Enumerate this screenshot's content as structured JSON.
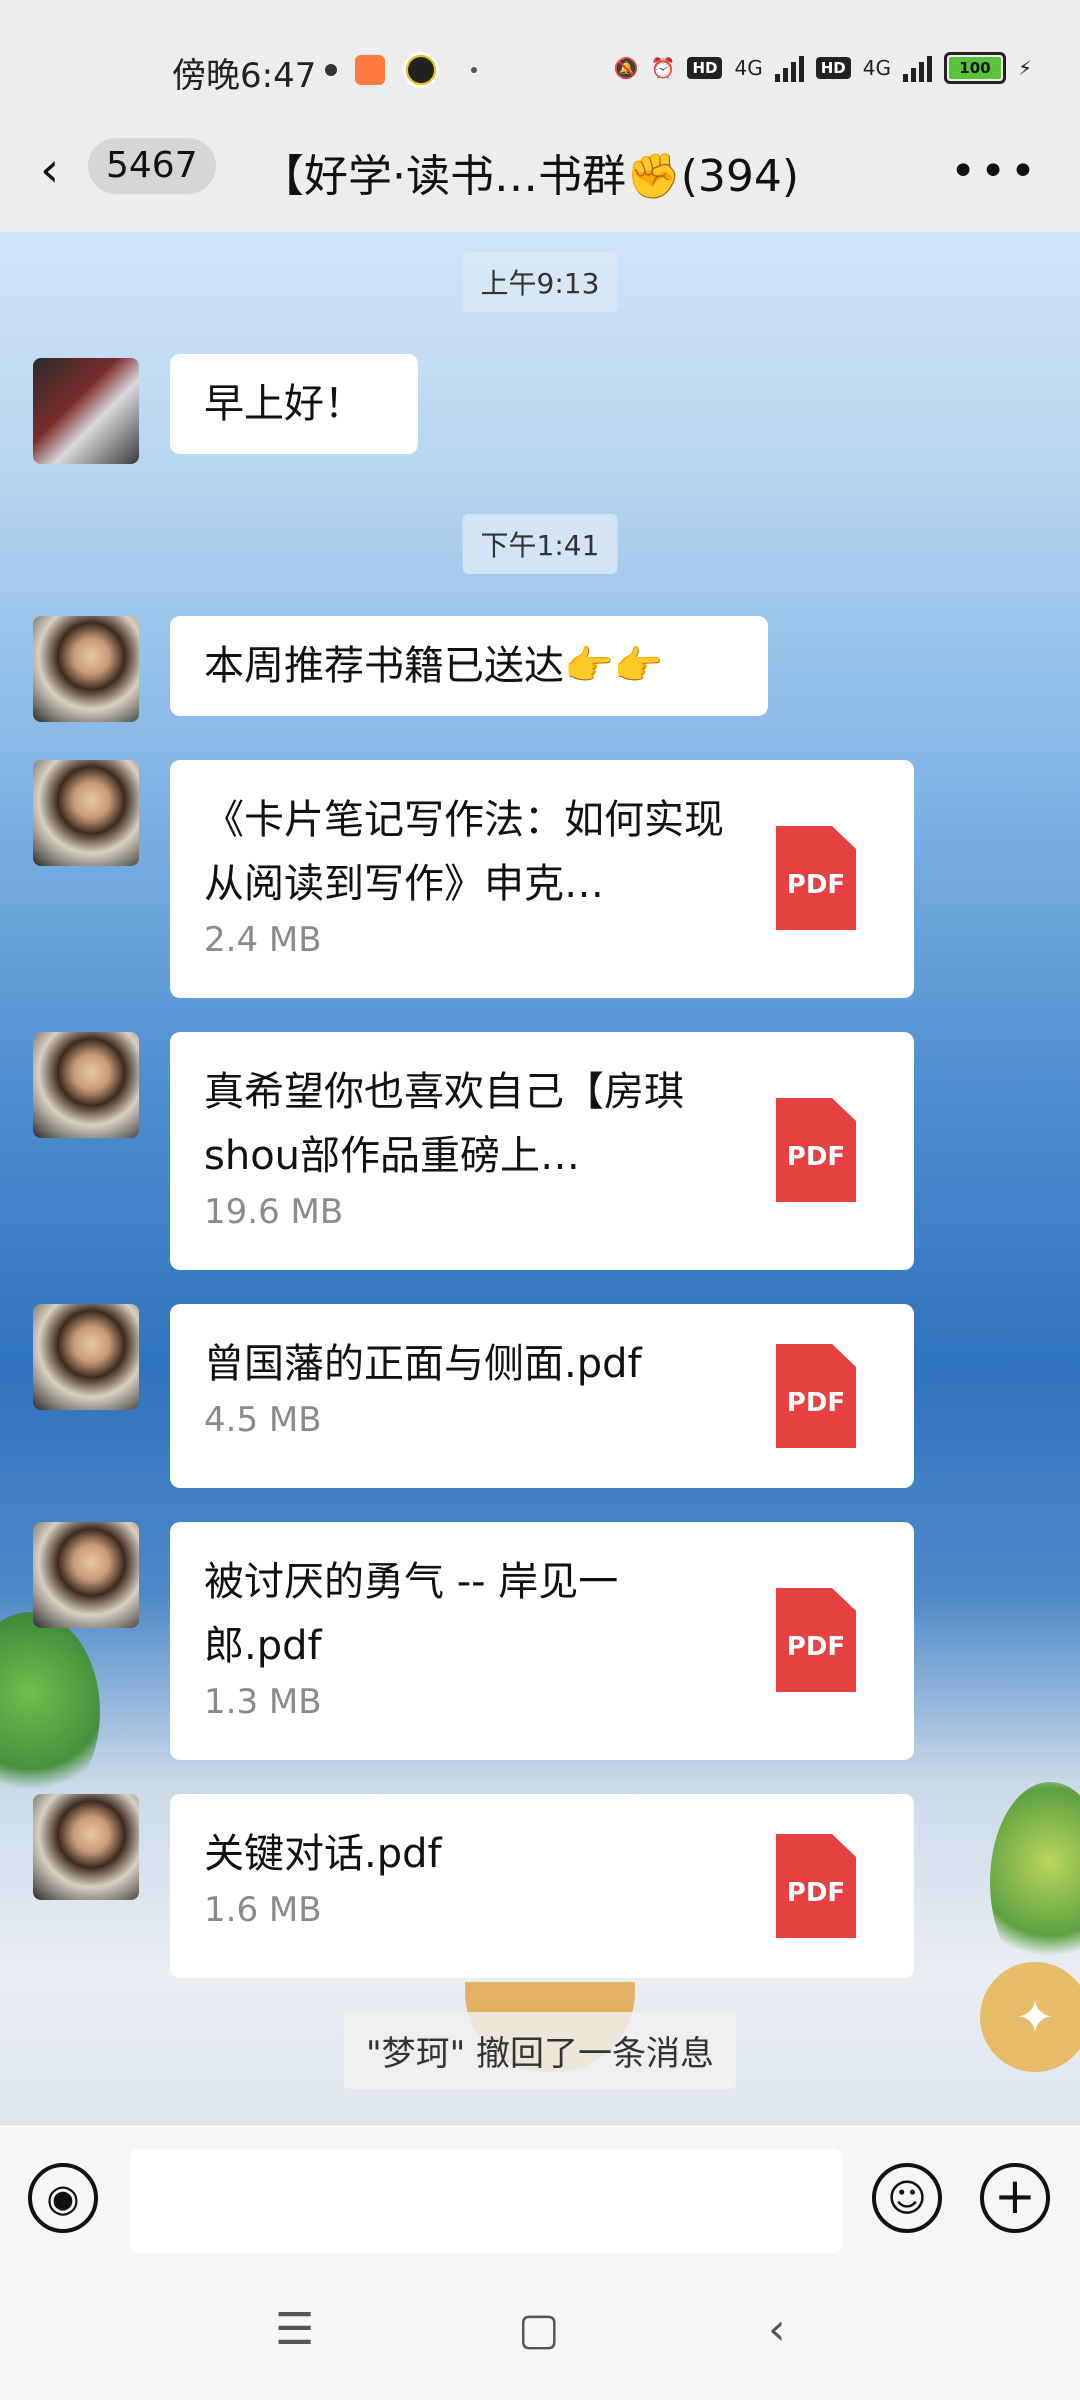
{
  "status_bar": {
    "time": "傍晚6:47",
    "network": "4G",
    "hd": "HD",
    "battery": "100"
  },
  "header": {
    "unread_count": "5467",
    "title": "【好学·读书…书群✊(394)"
  },
  "messages": {
    "time1": "上午9:13",
    "greeting": "早上好！",
    "time2": "下午1:41",
    "recommend": "本周推荐书籍已送达👉👉",
    "files": [
      {
        "name": "《卡片笔记写作法：如何实现从阅读到写作》申克…",
        "size": "2.4 MB",
        "icon": "PDF"
      },
      {
        "name": "真希望你也喜欢自己【房琪shou部作品重磅上…",
        "size": "19.6 MB",
        "icon": "PDF"
      },
      {
        "name": "曾国藩的正面与侧面.pdf",
        "size": "4.5 MB",
        "icon": "PDF"
      },
      {
        "name": "被讨厌的勇气 -- 岸见一郎.pdf",
        "size": "1.3 MB",
        "icon": "PDF"
      },
      {
        "name": "关键对话.pdf",
        "size": "1.6 MB",
        "icon": "PDF"
      }
    ],
    "recall_notice": "\"梦珂\" 撤回了一条消息"
  },
  "colors": {
    "pdf_red": "#e64141",
    "bubble": "#ffffff",
    "background": "#ededed"
  },
  "icons": {
    "back": "chevron-left-icon",
    "more": "more-icon",
    "voice": "voice-icon",
    "emoji": "emoji-icon",
    "plus": "plus-icon"
  }
}
